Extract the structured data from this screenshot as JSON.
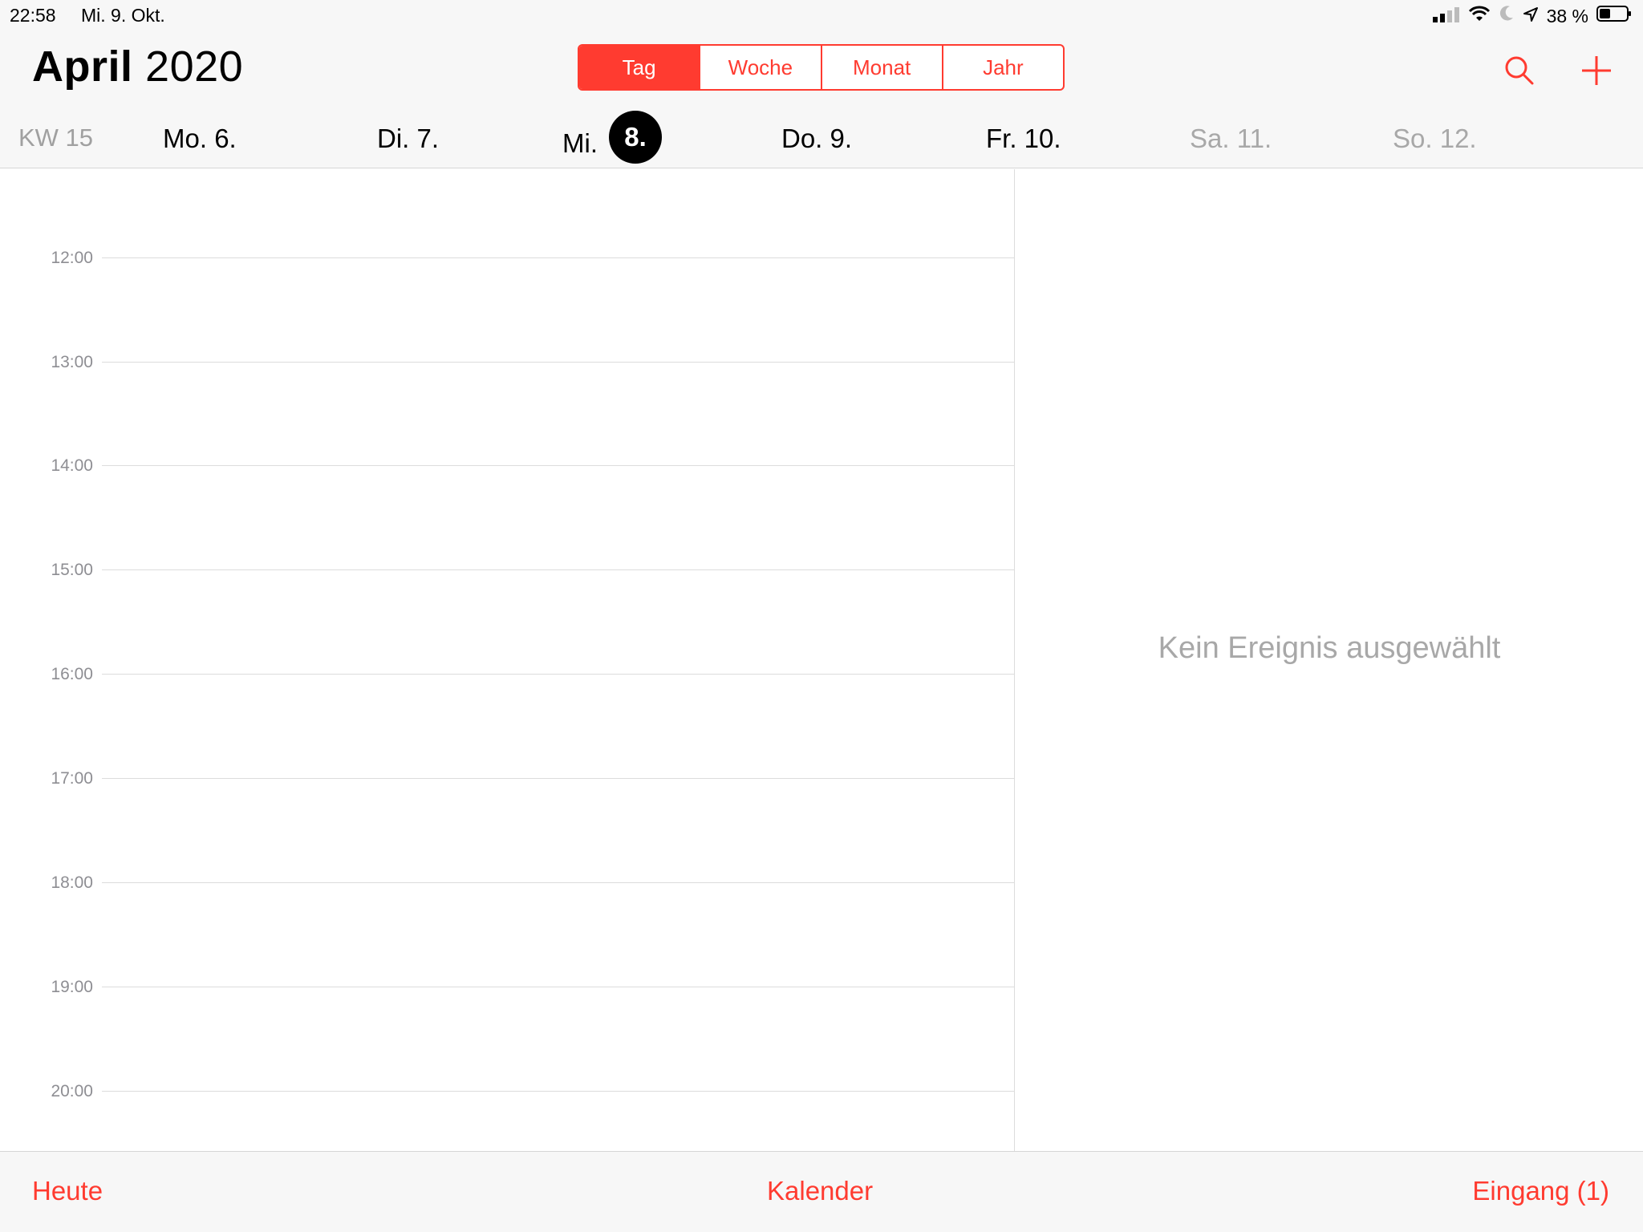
{
  "status_bar": {
    "time": "22:58",
    "date": "Mi. 9. Okt.",
    "battery": "38 %",
    "icons": [
      "signal-icon",
      "wifi-icon",
      "moon-icon",
      "location-icon",
      "battery-icon"
    ]
  },
  "header": {
    "month": "April",
    "year": "2020",
    "segments": [
      {
        "label": "Tag",
        "active": true
      },
      {
        "label": "Woche",
        "active": false
      },
      {
        "label": "Monat",
        "active": false
      },
      {
        "label": "Jahr",
        "active": false
      }
    ],
    "search_icon": "search-icon",
    "add_icon": "plus-icon"
  },
  "week": {
    "label": "KW 15",
    "days": [
      {
        "name": "Mo.",
        "num": "6."
      },
      {
        "name": "Di.",
        "num": "7."
      },
      {
        "name": "Mi.",
        "num": "8.",
        "selected": true
      },
      {
        "name": "Do.",
        "num": "9."
      },
      {
        "name": "Fr.",
        "num": "10."
      },
      {
        "name": "Sa.",
        "num": "11.",
        "weekend": true
      },
      {
        "name": "So.",
        "num": "12.",
        "weekend": true
      }
    ]
  },
  "hours": [
    "12:00",
    "13:00",
    "14:00",
    "15:00",
    "16:00",
    "17:00",
    "18:00",
    "19:00",
    "20:00"
  ],
  "detail": {
    "empty_text": "Kein Ereignis ausgewählt"
  },
  "bottom_bar": {
    "today": "Heute",
    "calendars": "Kalender",
    "inbox": "Eingang (1)"
  },
  "colors": {
    "accent": "#ff3b30",
    "text_muted": "#a8a8a8",
    "bar_bg": "#f7f7f7"
  }
}
